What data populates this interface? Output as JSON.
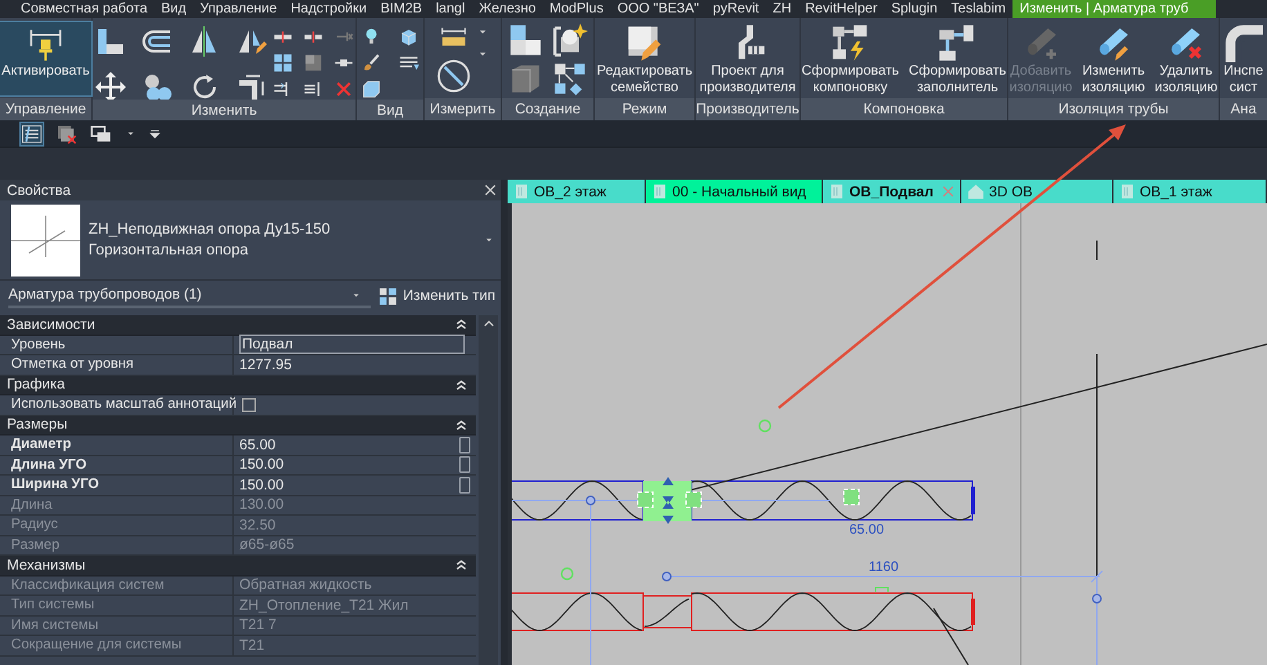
{
  "menu_tabs": [
    {
      "label": "Совместная работа",
      "selected": false
    },
    {
      "label": "Вид",
      "selected": false
    },
    {
      "label": "Управление",
      "selected": false
    },
    {
      "label": "Надстройки",
      "selected": false
    },
    {
      "label": "BIM2B",
      "selected": false
    },
    {
      "label": "langl",
      "selected": false
    },
    {
      "label": "Железно",
      "selected": false
    },
    {
      "label": "ModPlus",
      "selected": false
    },
    {
      "label": "ООО \"ВЕЗА\"",
      "selected": false
    },
    {
      "label": "pyRevit",
      "selected": false
    },
    {
      "label": "ZH",
      "selected": false
    },
    {
      "label": "RevitHelper",
      "selected": false
    },
    {
      "label": "Splugin",
      "selected": false
    },
    {
      "label": "Teslabim",
      "selected": false
    },
    {
      "label": "Изменить | Арматура труб",
      "selected": true
    }
  ],
  "ribbon": {
    "panels": [
      {
        "label": "Управление",
        "kind": "buttons",
        "buttons": [
          {
            "label": "Активировать",
            "selected": true,
            "disabled": false
          }
        ]
      },
      {
        "label": "Изменить",
        "kind": "tools"
      },
      {
        "label": "Вид",
        "kind": "tools"
      },
      {
        "label": "Измерить",
        "kind": "tools"
      },
      {
        "label": "Создание",
        "kind": "tools"
      },
      {
        "label": "Режим",
        "kind": "buttons",
        "buttons": [
          {
            "label": "Редактировать\nсемейство",
            "selected": false,
            "disabled": false
          }
        ]
      },
      {
        "label": "Производитель",
        "kind": "buttons",
        "buttons": [
          {
            "label": "Проект для\nпроизводителя",
            "selected": false,
            "disabled": false
          }
        ]
      },
      {
        "label": "Компоновка",
        "kind": "buttons",
        "buttons": [
          {
            "label": "Сформировать\nкомпоновку",
            "selected": false,
            "disabled": false
          },
          {
            "label": "Сформировать\nзаполнитель",
            "selected": false,
            "disabled": false
          }
        ]
      },
      {
        "label": "Изоляция трубы",
        "kind": "buttons",
        "buttons": [
          {
            "label": "Добавить\nизоляцию",
            "selected": false,
            "disabled": true
          },
          {
            "label": "Изменить\nизоляцию",
            "selected": false,
            "disabled": false
          },
          {
            "label": "Удалить\nизоляцию",
            "selected": false,
            "disabled": false
          }
        ]
      },
      {
        "label": "Ана",
        "kind": "buttons",
        "buttons": [
          {
            "label": "Инспе\nсист",
            "selected": false,
            "disabled": false
          }
        ]
      }
    ]
  },
  "properties": {
    "title": "Свойства",
    "type_name": "ZH_Неподвижная опора Ду15-150",
    "type_subname": "Горизонтальная опора",
    "filter": "Арматура трубопроводов (1)",
    "edit_type_button": "Изменить тип",
    "sections": [
      {
        "title": "Зависимости",
        "expanded": true,
        "rows": [
          {
            "label": "Уровень",
            "value": "Подвал",
            "kind": "field",
            "disabled": false,
            "param_button": false
          },
          {
            "label": "Отметка от уровня",
            "value": "1277.95",
            "kind": "text",
            "disabled": false,
            "param_button": false
          }
        ]
      },
      {
        "title": "Графика",
        "expanded": true,
        "rows": [
          {
            "label": "Использовать масштаб аннотаций",
            "kind": "checkbox",
            "checked": false,
            "disabled": false,
            "param_button": false
          }
        ]
      },
      {
        "title": "Размеры",
        "expanded": true,
        "rows": [
          {
            "label": "Диаметр",
            "value": "65.00",
            "kind": "text",
            "disabled": false,
            "param_button": true
          },
          {
            "label": "Длина УГО",
            "value": "150.00",
            "kind": "text",
            "disabled": false,
            "param_button": true
          },
          {
            "label": "Ширина УГО",
            "value": "150.00",
            "kind": "text",
            "disabled": false,
            "param_button": true
          },
          {
            "label": "Длина",
            "value": "130.00",
            "kind": "text",
            "disabled": true,
            "param_button": false
          },
          {
            "label": "Радиус",
            "value": "32.50",
            "kind": "text",
            "disabled": true,
            "param_button": false
          },
          {
            "label": "Размер",
            "value": "ø65-ø65",
            "kind": "text",
            "disabled": true,
            "param_button": false
          }
        ]
      },
      {
        "title": "Механизмы",
        "expanded": true,
        "rows": [
          {
            "label": "Классификация систем",
            "value": "Обратная жидкость",
            "kind": "text",
            "disabled": true,
            "param_button": false
          },
          {
            "label": "Тип системы",
            "value": "ZH_Отопление_T21 Жил",
            "kind": "text",
            "disabled": true,
            "param_button": false
          },
          {
            "label": "Имя системы",
            "value": "T21 7",
            "kind": "text",
            "disabled": true,
            "param_button": false
          },
          {
            "label": "Сокращение для системы",
            "value": "T21",
            "kind": "text",
            "disabled": true,
            "param_button": false
          }
        ]
      }
    ]
  },
  "view_tabs": [
    {
      "label": "ОВ_2 этаж",
      "selected": false,
      "closable": false,
      "color": "#48dcca"
    },
    {
      "label": "00 - Начальный вид",
      "selected": false,
      "closable": false,
      "color": "#00f29a"
    },
    {
      "label": "ОВ_Подвал",
      "selected": true,
      "closable": true,
      "color": "#48dcca"
    },
    {
      "label": "3D ОВ",
      "selected": false,
      "closable": false,
      "color": "#48dcca"
    },
    {
      "label": "ОВ_1 этаж",
      "selected": false,
      "closable": false,
      "color": "#48dcca"
    }
  ],
  "canvas": {
    "labels": [
      "65.00",
      "1160"
    ]
  }
}
